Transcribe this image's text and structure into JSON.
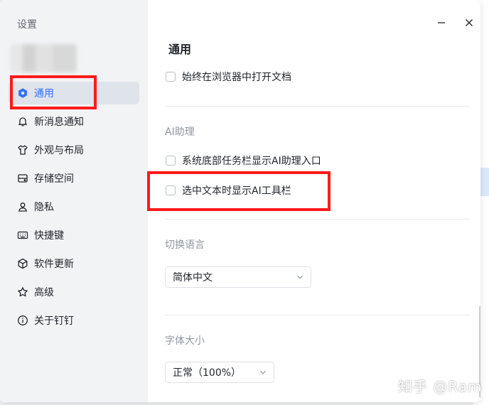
{
  "sidebar": {
    "title": "设置",
    "items": [
      {
        "label": "通用",
        "icon": "gear-icon",
        "active": true
      },
      {
        "label": "新消息通知",
        "icon": "bell-icon"
      },
      {
        "label": "外观与布局",
        "icon": "shirt-icon"
      },
      {
        "label": "存储空间",
        "icon": "drive-icon"
      },
      {
        "label": "隐私",
        "icon": "user-icon"
      },
      {
        "label": "快捷键",
        "icon": "keyboard-icon"
      },
      {
        "label": "软件更新",
        "icon": "cube-icon"
      },
      {
        "label": "高级",
        "icon": "star-icon"
      },
      {
        "label": "关于钉钉",
        "icon": "info-icon"
      }
    ]
  },
  "window_controls": {
    "minimize": "minimize-icon",
    "close": "close-icon"
  },
  "main": {
    "title": "通用",
    "open_in_browser": {
      "label": "始终在浏览器中打开文档",
      "checked": false
    },
    "ai": {
      "section_label": "AI助理",
      "taskbar_entry": {
        "label": "系统底部任务栏显示AI助理入口",
        "checked": false
      },
      "selection_toolbar": {
        "label": "选中文本时显示AI工具栏",
        "checked": false
      }
    },
    "language": {
      "section_label": "切换语言",
      "value": "简体中文"
    },
    "font_size": {
      "section_label": "字体大小",
      "value": "正常（100%）"
    }
  },
  "watermark": "知乎 @Ram",
  "colors": {
    "accent": "#3370ff",
    "highlight": "#ff1a1a",
    "sidebar_bg": "#f2f3f5"
  }
}
